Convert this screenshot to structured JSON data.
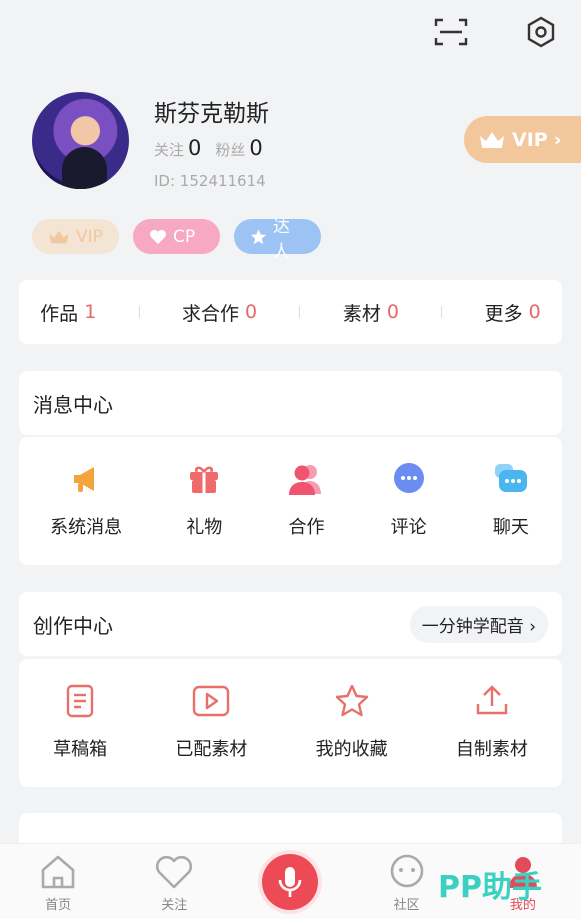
{
  "topbar": {
    "icons": [
      "scan-icon",
      "settings-icon"
    ]
  },
  "profile": {
    "username": "斯芬克勒斯",
    "follow_label": "关注",
    "follow_count": "0",
    "fans_label": "粉丝",
    "fans_count": "0",
    "id_text": "ID: 152411614"
  },
  "vip_button": {
    "label": "VIP"
  },
  "badges": {
    "vip": "VIP",
    "cp": "CP",
    "expert": "达人"
  },
  "counts": [
    {
      "label": "作品",
      "value": "1"
    },
    {
      "label": "求合作",
      "value": "0"
    },
    {
      "label": "素材",
      "value": "0"
    },
    {
      "label": "更多",
      "value": "0"
    }
  ],
  "messages": {
    "title": "消息中心",
    "items": [
      {
        "label": "系统消息",
        "icon": "megaphone-icon",
        "color": "#f4a43d"
      },
      {
        "label": "礼物",
        "icon": "gift-icon",
        "color": "#ef6a6a"
      },
      {
        "label": "合作",
        "icon": "people-icon",
        "color": "#f36b8a"
      },
      {
        "label": "评论",
        "icon": "comment-icon",
        "color": "#6b8cf0"
      },
      {
        "label": "聊天",
        "icon": "chat-icon",
        "color": "#49b6f0"
      }
    ]
  },
  "creation": {
    "title": "创作中心",
    "learn_button": "一分钟学配音",
    "items": [
      {
        "label": "草稿箱",
        "icon": "draft-icon"
      },
      {
        "label": "已配素材",
        "icon": "video-icon"
      },
      {
        "label": "我的收藏",
        "icon": "star-icon"
      },
      {
        "label": "自制素材",
        "icon": "upload-icon"
      }
    ]
  },
  "tabs": [
    {
      "label": "首页",
      "icon": "home-icon"
    },
    {
      "label": "关注",
      "icon": "heart-icon"
    },
    {
      "label": "",
      "icon": "mic-icon"
    },
    {
      "label": "社区",
      "icon": "community-icon"
    },
    {
      "label": "我的",
      "icon": "me-icon"
    }
  ],
  "watermark": "PP助手",
  "accent": "#e36a6a"
}
